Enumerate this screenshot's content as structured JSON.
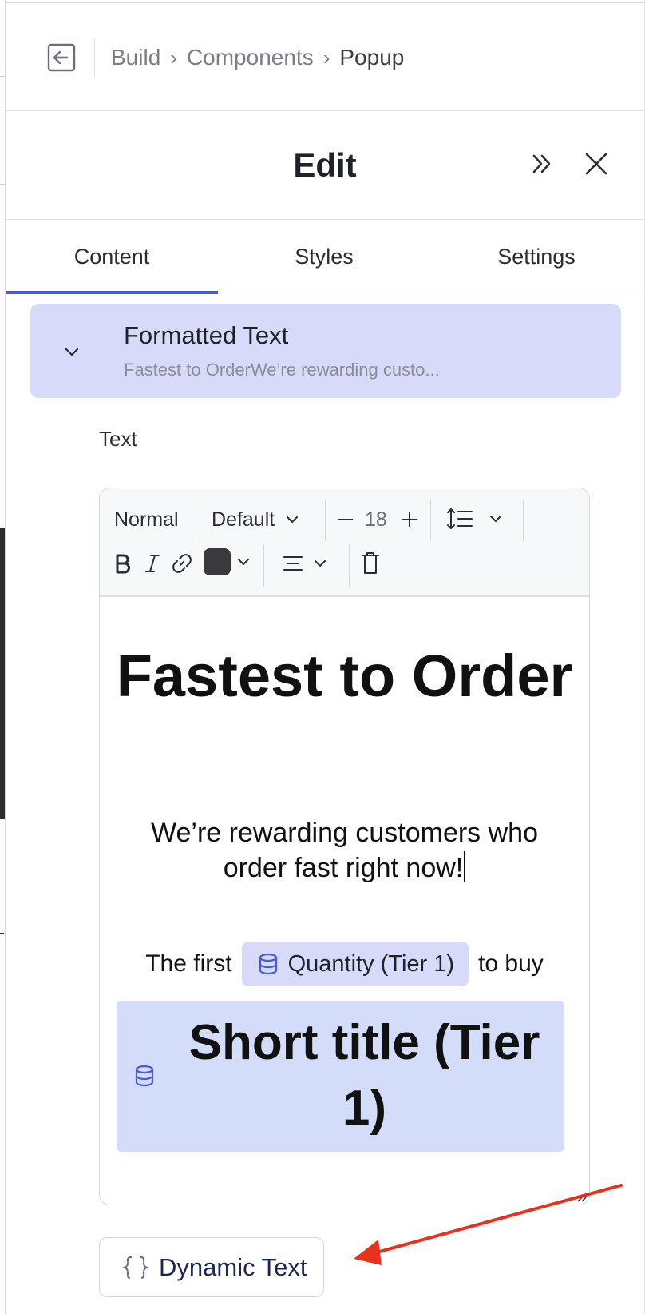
{
  "breadcrumb": {
    "items": [
      "Build",
      "Components",
      "Popup"
    ],
    "separator": "›"
  },
  "header": {
    "title": "Edit"
  },
  "tabs": [
    {
      "label": "Content",
      "active": true
    },
    {
      "label": "Styles",
      "active": false
    },
    {
      "label": "Settings",
      "active": false
    }
  ],
  "section": {
    "title": "Formatted Text",
    "preview": "Fastest to OrderWe’re rewarding custo..."
  },
  "field": {
    "label": "Text"
  },
  "toolbar": {
    "paragraph_style": "Normal",
    "font": "Default",
    "font_size": "18",
    "minus": "—",
    "plus": "+",
    "text_color": "#3a3a3c"
  },
  "editor": {
    "heading": "Fastest to Order",
    "paragraph": "We’re rewarding customers who order fast right now!",
    "line_prefix": "The first",
    "chip_label": "Quantity (Tier 1)",
    "line_suffix": "to buy",
    "dynamic_block": "Short title (Tier 1)"
  },
  "dynamic_button": {
    "label": "Dynamic Text"
  },
  "colors": {
    "accent": "#4b5bd6",
    "chip_bg": "#d7dbf9",
    "annotation_arrow": "#e8321e"
  }
}
